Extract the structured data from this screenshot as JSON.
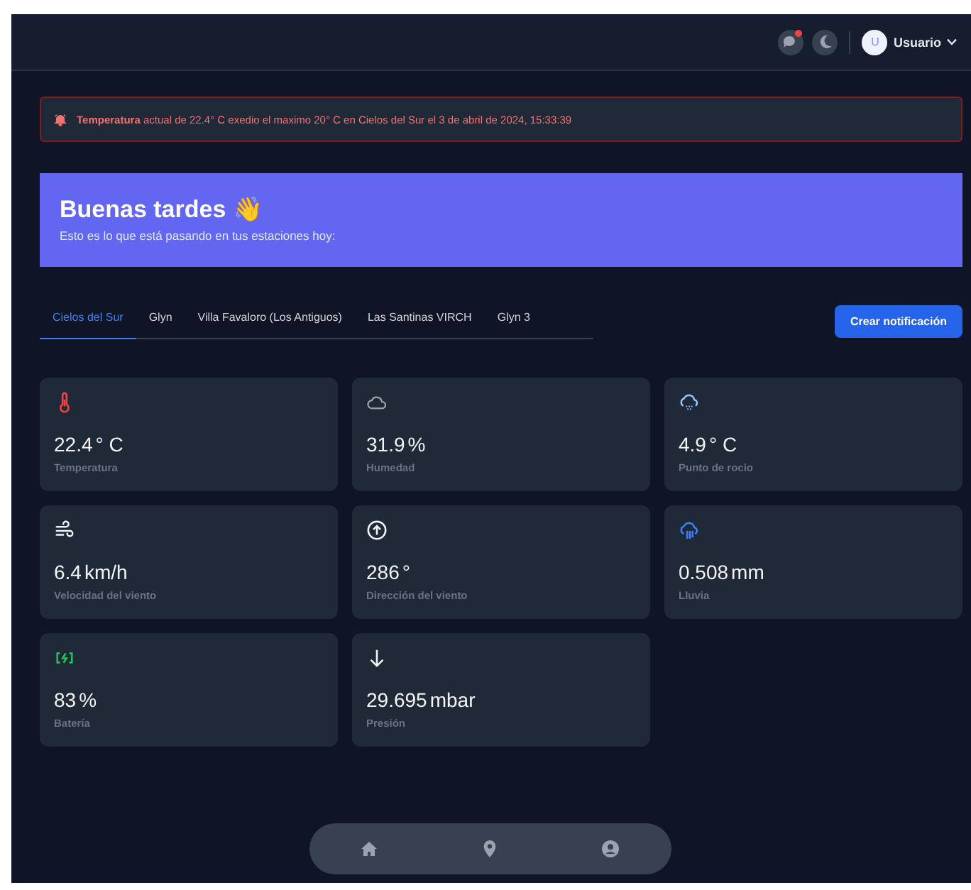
{
  "header": {
    "notification_dot": true,
    "user": {
      "initial": "U",
      "name": "Usuario"
    }
  },
  "alert": {
    "text": "**Temperatura** actual de 22.4° C exedio el maximo 20° C en Cielos del Sur el 3 de abril de 2024, 15:33:39"
  },
  "banner": {
    "title": "Buenas tardes 👋",
    "subtitle": "Esto es lo que está pasando en tus estaciones hoy:"
  },
  "tabs": [
    {
      "label": "Cielos del Sur",
      "selected": true
    },
    {
      "label": "Glyn",
      "selected": false
    },
    {
      "label": "Villa Favaloro (Los Antiguos)",
      "selected": false
    },
    {
      "label": "Las Santinas VIRCH",
      "selected": false
    },
    {
      "label": "Glyn 3",
      "selected": false
    }
  ],
  "create_button": "Crear notificación",
  "cards": [
    {
      "kind": "thermometer",
      "value": "22.4",
      "unit": "° C",
      "label": "Temperatura"
    },
    {
      "kind": "cloud",
      "value": "31.9",
      "unit": "%",
      "label": "Humedad"
    },
    {
      "kind": "dew",
      "value": "4.9",
      "unit": "° C",
      "label": "Punto de rocio"
    },
    {
      "kind": "wind",
      "value": "6.4",
      "unit": "km/h",
      "label": "Velocidad del viento"
    },
    {
      "kind": "direction",
      "value": "286",
      "unit": "°",
      "label": "Dirección del viento"
    },
    {
      "kind": "rain",
      "value": "0.508",
      "unit": "mm",
      "label": "Lluvia"
    },
    {
      "kind": "battery",
      "value": "83",
      "unit": "%",
      "label": "Batería"
    },
    {
      "kind": "pressure",
      "value": "29.695",
      "unit": "mbar",
      "label": "Presión"
    }
  ],
  "bottom_nav": [
    {
      "kind": "home"
    },
    {
      "kind": "pin"
    },
    {
      "kind": "user"
    }
  ]
}
